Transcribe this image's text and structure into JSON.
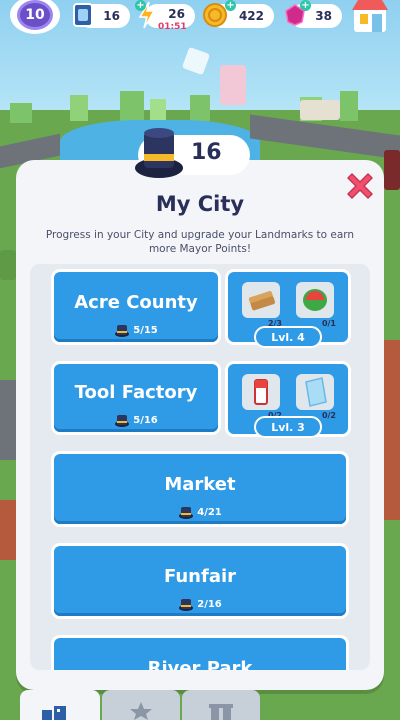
{
  "hud": {
    "level": "10",
    "cards": "16",
    "energy": "26",
    "energy_timer": "01:51",
    "coins": "422",
    "gems": "38",
    "plus": "+"
  },
  "modal": {
    "mayor_points": "16",
    "title": "My City",
    "subtitle": "Progress in your City and upgrade your Landmarks to earn more Mayor Points!"
  },
  "landmarks": [
    {
      "name": "Acre County",
      "progress": "5/15",
      "upgrade": {
        "items": [
          {
            "count": "2/3",
            "icon": "wood-planks-icon"
          },
          {
            "count": "0/1",
            "icon": "watermelon-icon"
          }
        ],
        "level": "Lvl. 4"
      }
    },
    {
      "name": "Tool Factory",
      "progress": "5/16",
      "upgrade": {
        "items": [
          {
            "count": "0/2",
            "icon": "paint-bucket-icon"
          },
          {
            "count": "0/2",
            "icon": "glass-pane-icon"
          }
        ],
        "level": "Lvl. 3"
      }
    },
    {
      "name": "Market",
      "progress": "4/21"
    },
    {
      "name": "Funfair",
      "progress": "2/16"
    },
    {
      "name": "River Park",
      "progress": ""
    }
  ],
  "colors": {
    "accent_blue": "#2f9ae6",
    "close_red": "#f0506e",
    "level_purple": "#6b4fc8",
    "text_dark": "#2a2f5a"
  }
}
